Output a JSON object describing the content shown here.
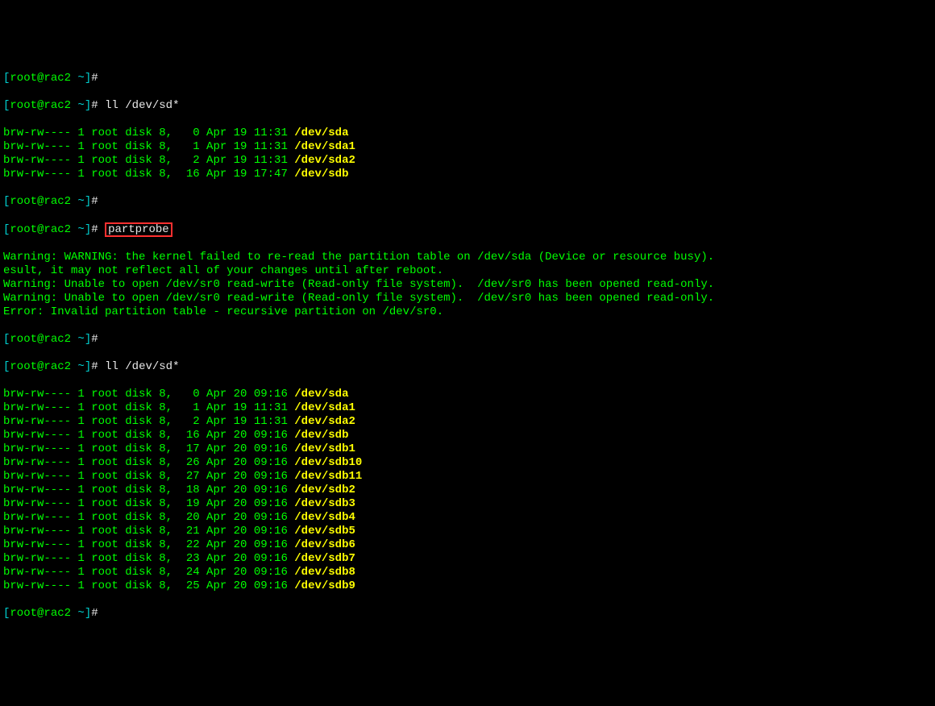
{
  "prompt": {
    "open": "[",
    "user_host": "root@rac2",
    "path": " ~",
    "close": "]",
    "hash": "# "
  },
  "cmd1": "ll /dev/sd*",
  "listing1": [
    {
      "perm": "brw-rw---- 1 root disk 8,   0 Apr 19 11:31 ",
      "dev": "/dev/sda"
    },
    {
      "perm": "brw-rw---- 1 root disk 8,   1 Apr 19 11:31 ",
      "dev": "/dev/sda1"
    },
    {
      "perm": "brw-rw---- 1 root disk 8,   2 Apr 19 11:31 ",
      "dev": "/dev/sda2"
    },
    {
      "perm": "brw-rw---- 1 root disk 8,  16 Apr 19 17:47 ",
      "dev": "/dev/sdb"
    }
  ],
  "cmd2": "partprobe",
  "warnings": [
    "Warning: WARNING: the kernel failed to re-read the partition table on /dev/sda (Device or resource busy).",
    "esult, it may not reflect all of your changes until after reboot.",
    "Warning: Unable to open /dev/sr0 read-write (Read-only file system).  /dev/sr0 has been opened read-only.",
    "Warning: Unable to open /dev/sr0 read-write (Read-only file system).  /dev/sr0 has been opened read-only.",
    "Error: Invalid partition table - recursive partition on /dev/sr0."
  ],
  "cmd3": "ll /dev/sd*",
  "listing2": [
    {
      "perm": "brw-rw---- 1 root disk 8,   0 Apr 20 09:16 ",
      "dev": "/dev/sda"
    },
    {
      "perm": "brw-rw---- 1 root disk 8,   1 Apr 19 11:31 ",
      "dev": "/dev/sda1"
    },
    {
      "perm": "brw-rw---- 1 root disk 8,   2 Apr 19 11:31 ",
      "dev": "/dev/sda2"
    },
    {
      "perm": "brw-rw---- 1 root disk 8,  16 Apr 20 09:16 ",
      "dev": "/dev/sdb"
    },
    {
      "perm": "brw-rw---- 1 root disk 8,  17 Apr 20 09:16 ",
      "dev": "/dev/sdb1"
    },
    {
      "perm": "brw-rw---- 1 root disk 8,  26 Apr 20 09:16 ",
      "dev": "/dev/sdb10"
    },
    {
      "perm": "brw-rw---- 1 root disk 8,  27 Apr 20 09:16 ",
      "dev": "/dev/sdb11"
    },
    {
      "perm": "brw-rw---- 1 root disk 8,  18 Apr 20 09:16 ",
      "dev": "/dev/sdb2"
    },
    {
      "perm": "brw-rw---- 1 root disk 8,  19 Apr 20 09:16 ",
      "dev": "/dev/sdb3"
    },
    {
      "perm": "brw-rw---- 1 root disk 8,  20 Apr 20 09:16 ",
      "dev": "/dev/sdb4"
    },
    {
      "perm": "brw-rw---- 1 root disk 8,  21 Apr 20 09:16 ",
      "dev": "/dev/sdb5"
    },
    {
      "perm": "brw-rw---- 1 root disk 8,  22 Apr 20 09:16 ",
      "dev": "/dev/sdb6"
    },
    {
      "perm": "brw-rw---- 1 root disk 8,  23 Apr 20 09:16 ",
      "dev": "/dev/sdb7"
    },
    {
      "perm": "brw-rw---- 1 root disk 8,  24 Apr 20 09:16 ",
      "dev": "/dev/sdb8"
    },
    {
      "perm": "brw-rw---- 1 root disk 8,  25 Apr 20 09:16 ",
      "dev": "/dev/sdb9"
    }
  ]
}
